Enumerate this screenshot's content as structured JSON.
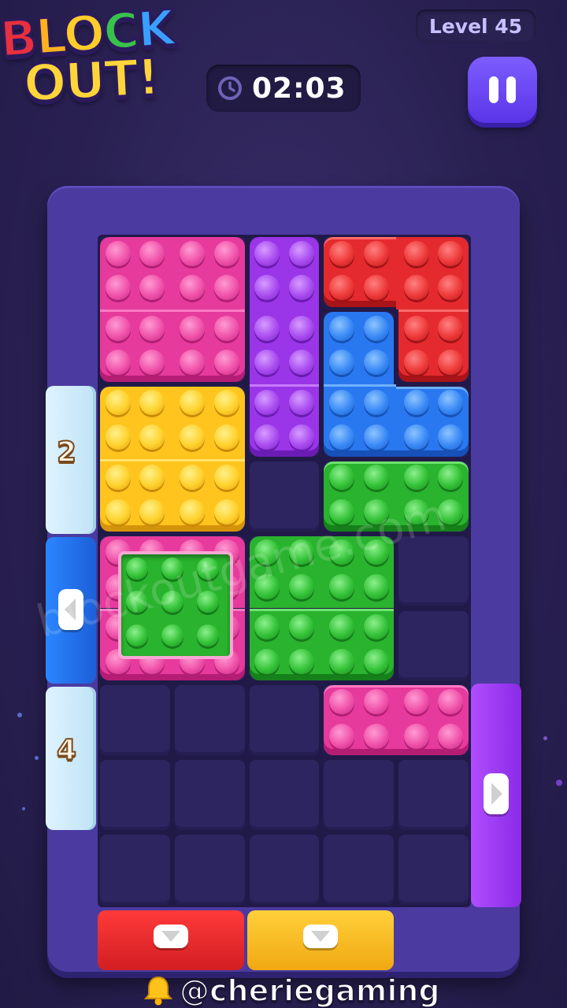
{
  "header": {
    "logo_top": [
      "B",
      "L",
      "O",
      "C",
      "K"
    ],
    "logo_bottom": "OUT!",
    "level_label": "Level 45",
    "timer": "02:03"
  },
  "board": {
    "columns": 5,
    "rows": 9,
    "blocks": [
      {
        "color": "pink",
        "cells": [
          [
            0,
            0
          ],
          [
            1,
            0
          ],
          [
            0,
            1
          ],
          [
            1,
            1
          ]
        ]
      },
      {
        "color": "purple",
        "cells": [
          [
            2,
            0
          ],
          [
            2,
            1
          ],
          [
            2,
            2
          ]
        ]
      },
      {
        "color": "red",
        "cells": [
          [
            3,
            0
          ],
          [
            4,
            0
          ],
          [
            4,
            1
          ]
        ]
      },
      {
        "color": "blue",
        "cells": [
          [
            3,
            1
          ],
          [
            3,
            2
          ],
          [
            4,
            2
          ]
        ]
      },
      {
        "color": "yellow",
        "cells": [
          [
            0,
            2
          ],
          [
            1,
            2
          ],
          [
            0,
            3
          ],
          [
            1,
            3
          ]
        ]
      },
      {
        "color": "green",
        "cells": [
          [
            3,
            3
          ],
          [
            4,
            3
          ]
        ]
      },
      {
        "color": "pink",
        "cells": [
          [
            0,
            4
          ],
          [
            1,
            4
          ],
          [
            0,
            5
          ],
          [
            1,
            5
          ]
        ],
        "inner": "green"
      },
      {
        "color": "green",
        "cells": [
          [
            2,
            4
          ],
          [
            3,
            4
          ],
          [
            2,
            5
          ],
          [
            3,
            5
          ]
        ]
      },
      {
        "color": "pink",
        "cells": [
          [
            3,
            6
          ],
          [
            4,
            6
          ]
        ]
      }
    ],
    "gates": [
      {
        "side": "left",
        "color": "ice",
        "counter": "2"
      },
      {
        "side": "left",
        "color": "blue",
        "arrow": "left"
      },
      {
        "side": "left",
        "color": "ice",
        "counter": "4"
      },
      {
        "side": "right",
        "color": "purple",
        "arrow": "right"
      },
      {
        "side": "bottom",
        "color": "red",
        "arrow": "down"
      },
      {
        "side": "bottom",
        "color": "yellow",
        "arrow": "down"
      }
    ]
  },
  "watermark": "blockoutgame.com",
  "footer": {
    "handle": "@cheriegaming"
  },
  "colors": {
    "background": "#2a2153",
    "frame": "#4b3aa0",
    "pink": "#e63a9c",
    "purple": "#9a35e8",
    "red": "#e52a2f",
    "blue": "#2a78f0",
    "yellow": "#ffc51e",
    "green": "#2ab32e"
  }
}
